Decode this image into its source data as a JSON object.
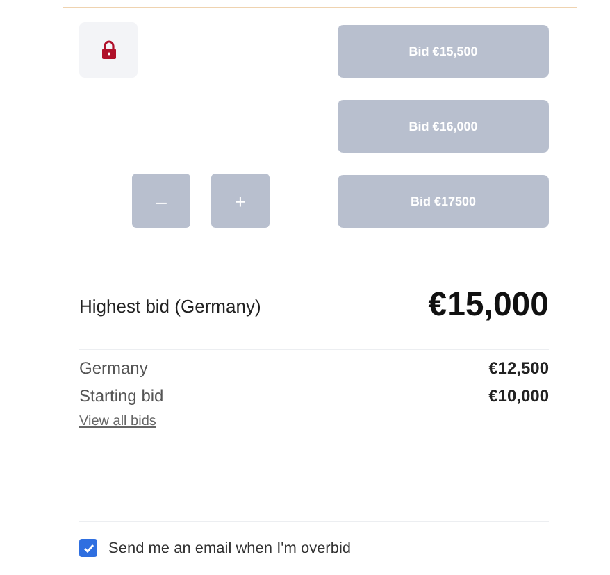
{
  "lock": {
    "locked": true
  },
  "stepper": [
    {
      "label": "–",
      "disabled": true
    },
    {
      "label": "+",
      "disabled": true
    }
  ],
  "bid_buttons": [
    {
      "label": "Bid €15,500",
      "disabled": true
    },
    {
      "label": "Bid €16,000",
      "disabled": true
    },
    {
      "label": "Bid €17500",
      "disabled": true
    }
  ],
  "highest": {
    "label": "Highest bid (Germany)",
    "amount": "€15,000"
  },
  "bids": [
    {
      "name": "Germany",
      "amount": "€12,500"
    },
    {
      "name": "Starting bid",
      "amount": "€10,000"
    }
  ],
  "view_all_link": "View all bids",
  "email_option": {
    "label": "Send me an email when I'm overbid",
    "checked": true
  }
}
